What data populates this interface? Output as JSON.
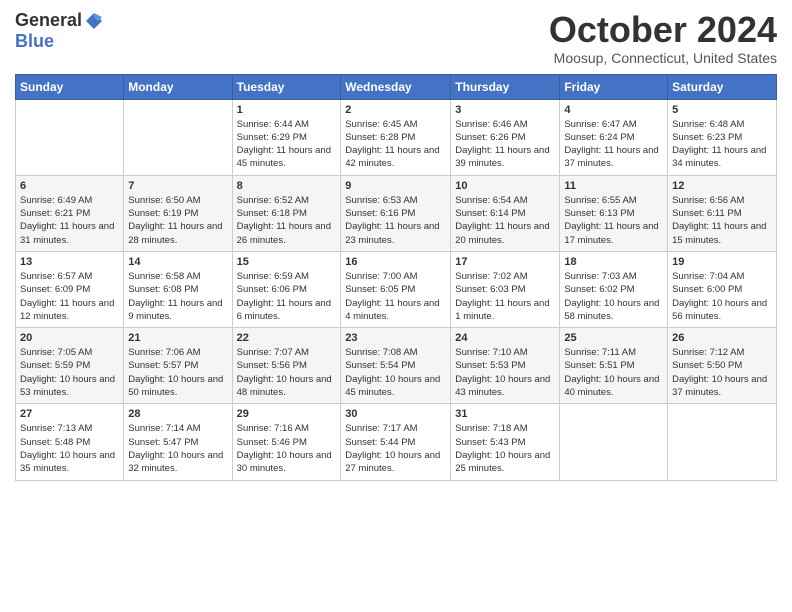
{
  "logo": {
    "general": "General",
    "blue": "Blue"
  },
  "title": "October 2024",
  "location": "Moosup, Connecticut, United States",
  "days_of_week": [
    "Sunday",
    "Monday",
    "Tuesday",
    "Wednesday",
    "Thursday",
    "Friday",
    "Saturday"
  ],
  "weeks": [
    [
      {
        "day": "",
        "sunrise": "",
        "sunset": "",
        "daylight": ""
      },
      {
        "day": "",
        "sunrise": "",
        "sunset": "",
        "daylight": ""
      },
      {
        "day": "1",
        "sunrise": "Sunrise: 6:44 AM",
        "sunset": "Sunset: 6:29 PM",
        "daylight": "Daylight: 11 hours and 45 minutes."
      },
      {
        "day": "2",
        "sunrise": "Sunrise: 6:45 AM",
        "sunset": "Sunset: 6:28 PM",
        "daylight": "Daylight: 11 hours and 42 minutes."
      },
      {
        "day": "3",
        "sunrise": "Sunrise: 6:46 AM",
        "sunset": "Sunset: 6:26 PM",
        "daylight": "Daylight: 11 hours and 39 minutes."
      },
      {
        "day": "4",
        "sunrise": "Sunrise: 6:47 AM",
        "sunset": "Sunset: 6:24 PM",
        "daylight": "Daylight: 11 hours and 37 minutes."
      },
      {
        "day": "5",
        "sunrise": "Sunrise: 6:48 AM",
        "sunset": "Sunset: 6:23 PM",
        "daylight": "Daylight: 11 hours and 34 minutes."
      }
    ],
    [
      {
        "day": "6",
        "sunrise": "Sunrise: 6:49 AM",
        "sunset": "Sunset: 6:21 PM",
        "daylight": "Daylight: 11 hours and 31 minutes."
      },
      {
        "day": "7",
        "sunrise": "Sunrise: 6:50 AM",
        "sunset": "Sunset: 6:19 PM",
        "daylight": "Daylight: 11 hours and 28 minutes."
      },
      {
        "day": "8",
        "sunrise": "Sunrise: 6:52 AM",
        "sunset": "Sunset: 6:18 PM",
        "daylight": "Daylight: 11 hours and 26 minutes."
      },
      {
        "day": "9",
        "sunrise": "Sunrise: 6:53 AM",
        "sunset": "Sunset: 6:16 PM",
        "daylight": "Daylight: 11 hours and 23 minutes."
      },
      {
        "day": "10",
        "sunrise": "Sunrise: 6:54 AM",
        "sunset": "Sunset: 6:14 PM",
        "daylight": "Daylight: 11 hours and 20 minutes."
      },
      {
        "day": "11",
        "sunrise": "Sunrise: 6:55 AM",
        "sunset": "Sunset: 6:13 PM",
        "daylight": "Daylight: 11 hours and 17 minutes."
      },
      {
        "day": "12",
        "sunrise": "Sunrise: 6:56 AM",
        "sunset": "Sunset: 6:11 PM",
        "daylight": "Daylight: 11 hours and 15 minutes."
      }
    ],
    [
      {
        "day": "13",
        "sunrise": "Sunrise: 6:57 AM",
        "sunset": "Sunset: 6:09 PM",
        "daylight": "Daylight: 11 hours and 12 minutes."
      },
      {
        "day": "14",
        "sunrise": "Sunrise: 6:58 AM",
        "sunset": "Sunset: 6:08 PM",
        "daylight": "Daylight: 11 hours and 9 minutes."
      },
      {
        "day": "15",
        "sunrise": "Sunrise: 6:59 AM",
        "sunset": "Sunset: 6:06 PM",
        "daylight": "Daylight: 11 hours and 6 minutes."
      },
      {
        "day": "16",
        "sunrise": "Sunrise: 7:00 AM",
        "sunset": "Sunset: 6:05 PM",
        "daylight": "Daylight: 11 hours and 4 minutes."
      },
      {
        "day": "17",
        "sunrise": "Sunrise: 7:02 AM",
        "sunset": "Sunset: 6:03 PM",
        "daylight": "Daylight: 11 hours and 1 minute."
      },
      {
        "day": "18",
        "sunrise": "Sunrise: 7:03 AM",
        "sunset": "Sunset: 6:02 PM",
        "daylight": "Daylight: 10 hours and 58 minutes."
      },
      {
        "day": "19",
        "sunrise": "Sunrise: 7:04 AM",
        "sunset": "Sunset: 6:00 PM",
        "daylight": "Daylight: 10 hours and 56 minutes."
      }
    ],
    [
      {
        "day": "20",
        "sunrise": "Sunrise: 7:05 AM",
        "sunset": "Sunset: 5:59 PM",
        "daylight": "Daylight: 10 hours and 53 minutes."
      },
      {
        "day": "21",
        "sunrise": "Sunrise: 7:06 AM",
        "sunset": "Sunset: 5:57 PM",
        "daylight": "Daylight: 10 hours and 50 minutes."
      },
      {
        "day": "22",
        "sunrise": "Sunrise: 7:07 AM",
        "sunset": "Sunset: 5:56 PM",
        "daylight": "Daylight: 10 hours and 48 minutes."
      },
      {
        "day": "23",
        "sunrise": "Sunrise: 7:08 AM",
        "sunset": "Sunset: 5:54 PM",
        "daylight": "Daylight: 10 hours and 45 minutes."
      },
      {
        "day": "24",
        "sunrise": "Sunrise: 7:10 AM",
        "sunset": "Sunset: 5:53 PM",
        "daylight": "Daylight: 10 hours and 43 minutes."
      },
      {
        "day": "25",
        "sunrise": "Sunrise: 7:11 AM",
        "sunset": "Sunset: 5:51 PM",
        "daylight": "Daylight: 10 hours and 40 minutes."
      },
      {
        "day": "26",
        "sunrise": "Sunrise: 7:12 AM",
        "sunset": "Sunset: 5:50 PM",
        "daylight": "Daylight: 10 hours and 37 minutes."
      }
    ],
    [
      {
        "day": "27",
        "sunrise": "Sunrise: 7:13 AM",
        "sunset": "Sunset: 5:48 PM",
        "daylight": "Daylight: 10 hours and 35 minutes."
      },
      {
        "day": "28",
        "sunrise": "Sunrise: 7:14 AM",
        "sunset": "Sunset: 5:47 PM",
        "daylight": "Daylight: 10 hours and 32 minutes."
      },
      {
        "day": "29",
        "sunrise": "Sunrise: 7:16 AM",
        "sunset": "Sunset: 5:46 PM",
        "daylight": "Daylight: 10 hours and 30 minutes."
      },
      {
        "day": "30",
        "sunrise": "Sunrise: 7:17 AM",
        "sunset": "Sunset: 5:44 PM",
        "daylight": "Daylight: 10 hours and 27 minutes."
      },
      {
        "day": "31",
        "sunrise": "Sunrise: 7:18 AM",
        "sunset": "Sunset: 5:43 PM",
        "daylight": "Daylight: 10 hours and 25 minutes."
      },
      {
        "day": "",
        "sunrise": "",
        "sunset": "",
        "daylight": ""
      },
      {
        "day": "",
        "sunrise": "",
        "sunset": "",
        "daylight": ""
      }
    ]
  ]
}
